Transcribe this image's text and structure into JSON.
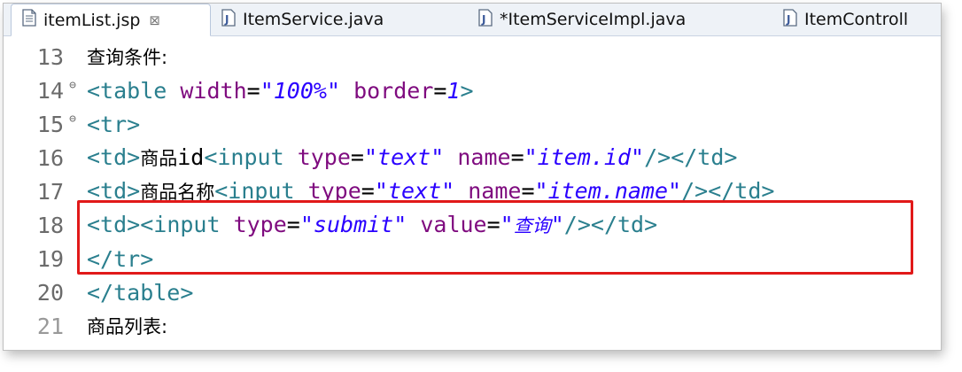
{
  "tabs": [
    {
      "label": "itemList.jsp",
      "icon": "jsp-file-icon",
      "active": true,
      "closable": true
    },
    {
      "label": "ItemService.java",
      "icon": "java-file-icon"
    },
    {
      "label": "*ItemServiceImpl.java",
      "icon": "java-file-icon"
    },
    {
      "label": "ItemControll",
      "icon": "java-file-icon"
    }
  ],
  "lines": [
    {
      "num": "13",
      "text": "查询条件:"
    },
    {
      "num": "14",
      "fold": "⊖",
      "p1": "<table ",
      "a1": "width",
      "eq1": "=",
      "s1": "\"100%\"",
      "sp": " ",
      "a2": "border",
      "eq2": "=",
      "v2": "1",
      "end": ">"
    },
    {
      "num": "15",
      "fold": "⊖",
      "p1": "<tr>"
    },
    {
      "num": "16",
      "td": "<td>",
      "label": "商品",
      "label2": "id",
      "p2": "<input ",
      "a1": "type",
      "eq": "=",
      "s1": "\"text\"",
      "sp": " ",
      "a2": "name",
      "s2": "\"item.id\"",
      "end": "/></td>"
    },
    {
      "num": "17",
      "td": "<td>",
      "label": "商品名称",
      "p2": "<input ",
      "a1": "type",
      "eq": "=",
      "s1": "\"text\"",
      "sp": " ",
      "a2": "name",
      "s2": "\"item.name\"",
      "end": "/></td>"
    },
    {
      "num": "18",
      "td": "<td>",
      "p2": "<input ",
      "a1": "type",
      "eq": "=",
      "s1": "\"submit\"",
      "sp": " ",
      "a2": "value",
      "s2q1": "\"",
      "s2": "查询",
      "s2q2": "\"",
      "end": "/></td>"
    },
    {
      "num": "19",
      "p1": "</tr>"
    },
    {
      "num": "20",
      "p1": "</table>"
    },
    {
      "num": "21",
      "text": "商品列表:"
    }
  ],
  "colors": {
    "highlight_border": "#e11919",
    "tag": "#2a7f8e",
    "attribute": "#7f0b7f",
    "string": "#2a00ff"
  }
}
